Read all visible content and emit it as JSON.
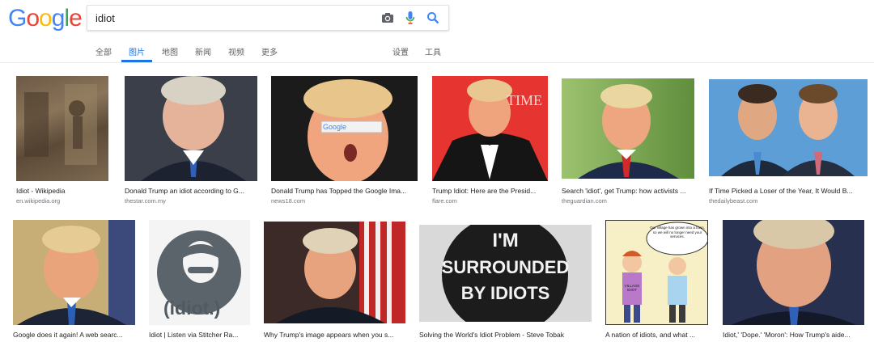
{
  "logo": {
    "letters": [
      "G",
      "o",
      "o",
      "g",
      "l",
      "e"
    ],
    "colors": [
      "#4285F4",
      "#EA4335",
      "#FBBC05",
      "#4285F4",
      "#34A853",
      "#EA4335"
    ]
  },
  "search": {
    "value": "idiot",
    "icons": [
      "camera-icon",
      "microphone-icon",
      "search-icon"
    ]
  },
  "tabs": {
    "all": "全部",
    "images": "图片",
    "maps": "地图",
    "news": "新闻",
    "videos": "视频",
    "more": "更多",
    "settings": "设置",
    "tools": "工具"
  },
  "row1": [
    {
      "caption": "Idiot - Wikipedia",
      "source": "en.wikipedia.org"
    },
    {
      "caption": "Donald Trump an idiot according to G...",
      "source": "thestar.com.my"
    },
    {
      "caption": "Donald Trump has Topped the Google Ima...",
      "source": "news18.com"
    },
    {
      "caption": "Trump Idiot: Here are the Presid...",
      "source": "flare.com"
    },
    {
      "caption": "Search 'idiot', get Trump: how activists ...",
      "source": "theguardian.com"
    },
    {
      "caption": "If Time Picked a Loser of the Year, It Would B...",
      "source": "thedailybeast.com"
    }
  ],
  "row2": [
    {
      "caption": "Google does it again! A web searc..."
    },
    {
      "caption": "Idiot | Listen via Stitcher Ra..."
    },
    {
      "caption": "Why Trump's image appears when you s..."
    },
    {
      "caption": "Solving the World's Idiot Problem - Steve Tobak"
    },
    {
      "caption": "A nation of idiots, and what ..."
    },
    {
      "caption": "Idiot,' 'Dope.' 'Moron': How Trump's aide..."
    }
  ],
  "image_text": {
    "google_bar": "Google",
    "time_logo": "TIME",
    "idiot_badge": "(idiot.)",
    "button_line1": "I'M",
    "button_line2": "SURROUNDED",
    "button_line3": "BY IDIOTS",
    "comic_bubble": "Our village has grown into a town, so we will no longer need your services.",
    "comic_sign": "VILLAGE IDIOT"
  }
}
